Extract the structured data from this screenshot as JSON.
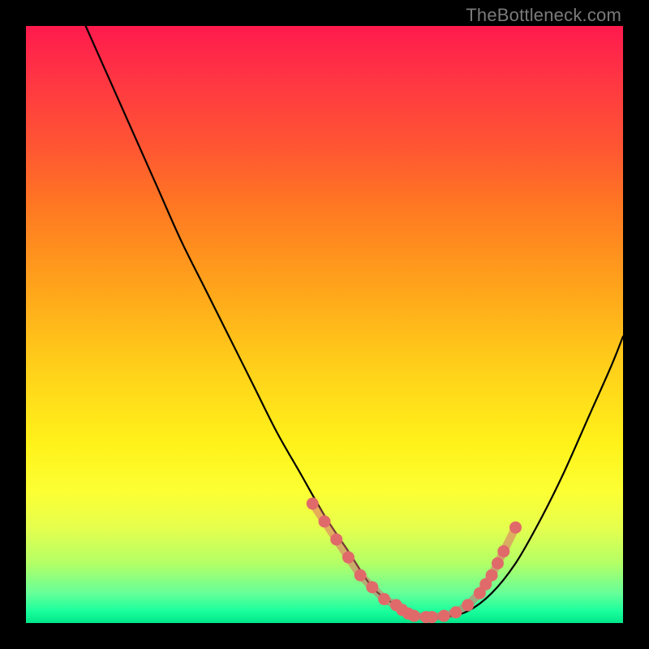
{
  "watermark": "TheBottleneck.com",
  "chart_data": {
    "type": "line",
    "title": "",
    "xlabel": "",
    "ylabel": "",
    "xlim": [
      0,
      100
    ],
    "ylim": [
      0,
      100
    ],
    "grid": false,
    "series": [
      {
        "name": "curve",
        "x": [
          10,
          14,
          18,
          22,
          26,
          30,
          34,
          38,
          42,
          46,
          50,
          54,
          58,
          62,
          66,
          70,
          74,
          78,
          82,
          86,
          90,
          94,
          98,
          100
        ],
        "values": [
          100,
          91,
          82,
          73,
          64,
          56,
          48,
          40,
          32,
          25,
          18,
          12,
          6,
          3,
          1,
          1,
          2,
          5,
          10,
          17,
          25,
          34,
          43,
          48
        ]
      }
    ],
    "markers": {
      "name": "dotted-segment",
      "color": "#e06a6a",
      "x": [
        48,
        50,
        52,
        54,
        56,
        58,
        60,
        62,
        63,
        64,
        65,
        67,
        68,
        70,
        72,
        74,
        76,
        77,
        78,
        79,
        80,
        82
      ],
      "values": [
        20,
        17,
        14,
        11,
        8,
        6,
        4,
        3,
        2.2,
        1.6,
        1.2,
        1,
        1,
        1.2,
        1.8,
        3,
        5,
        6.5,
        8,
        10,
        12,
        16
      ]
    }
  }
}
